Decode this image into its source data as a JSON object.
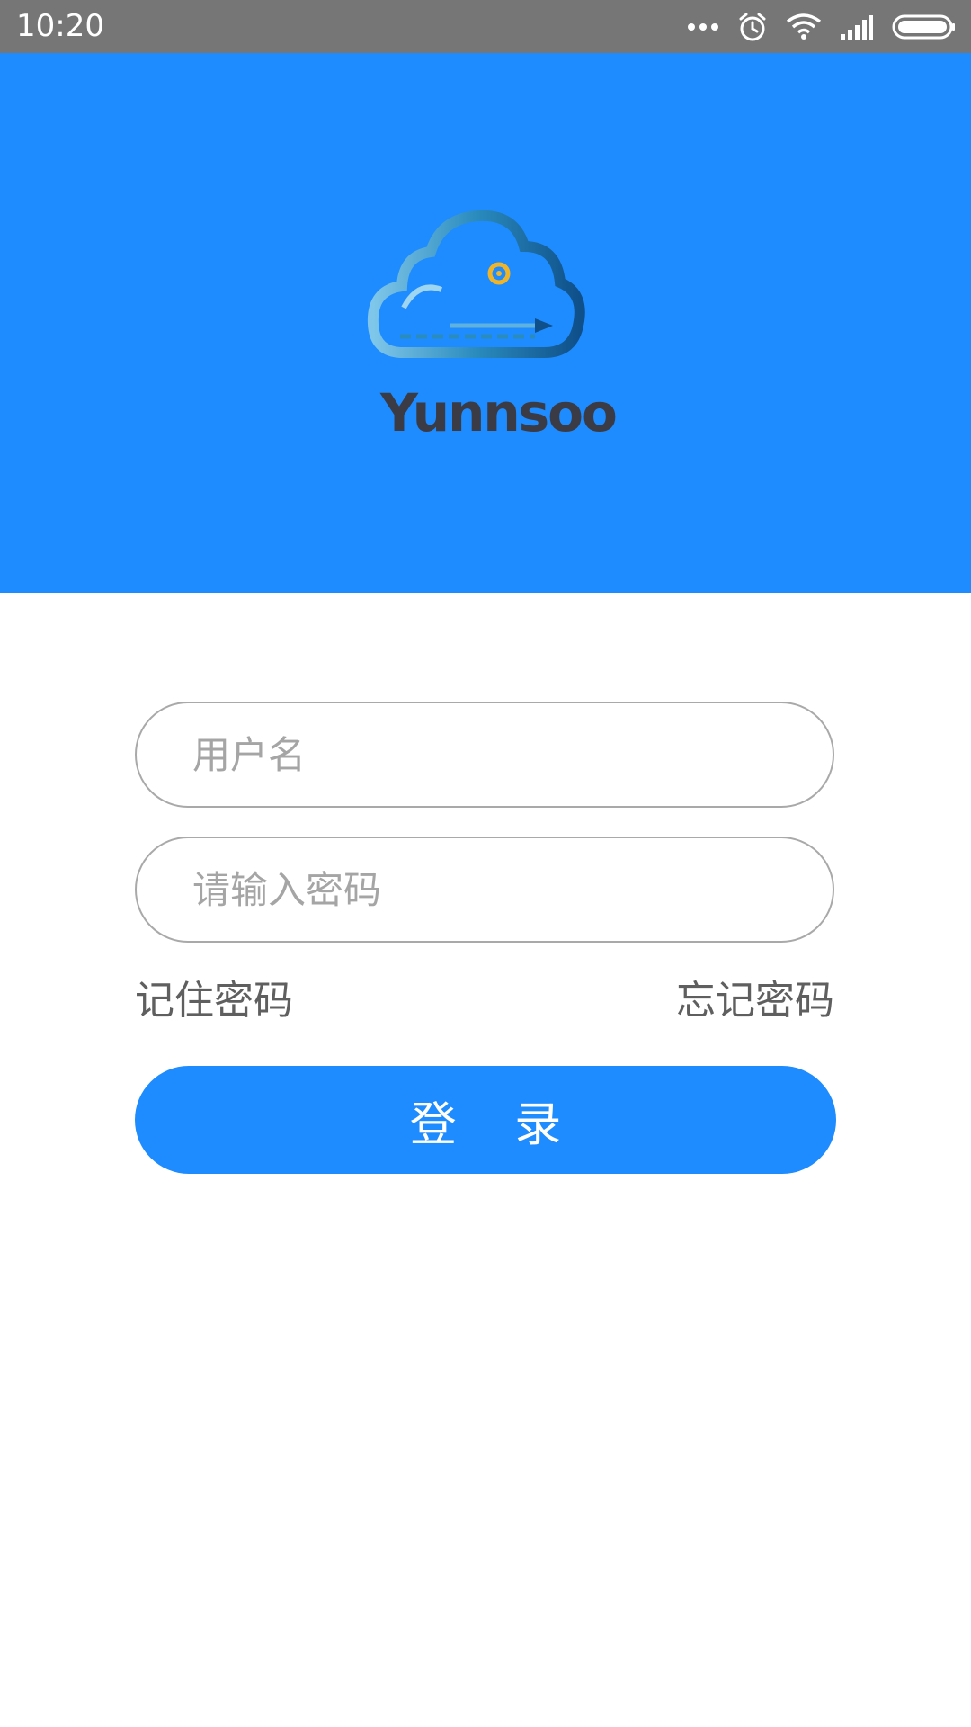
{
  "status_bar": {
    "time": "10:20",
    "icons": [
      "more-dots-icon",
      "alarm-icon",
      "wifi-icon",
      "signal-icon",
      "battery-icon"
    ]
  },
  "header": {
    "logo_text": "Yunnsoo",
    "logo_icon": "cloud-logo-icon"
  },
  "login_form": {
    "username_placeholder": "用户名",
    "password_placeholder": "请输入密码",
    "remember_password": "记住密码",
    "forgot_password": "忘记密码",
    "login_button": "登 录"
  },
  "colors": {
    "primary": "#1e8cfe",
    "status_bar": "#767676",
    "input_border": "#a9a9a9",
    "link_text": "#5f5f5f"
  }
}
